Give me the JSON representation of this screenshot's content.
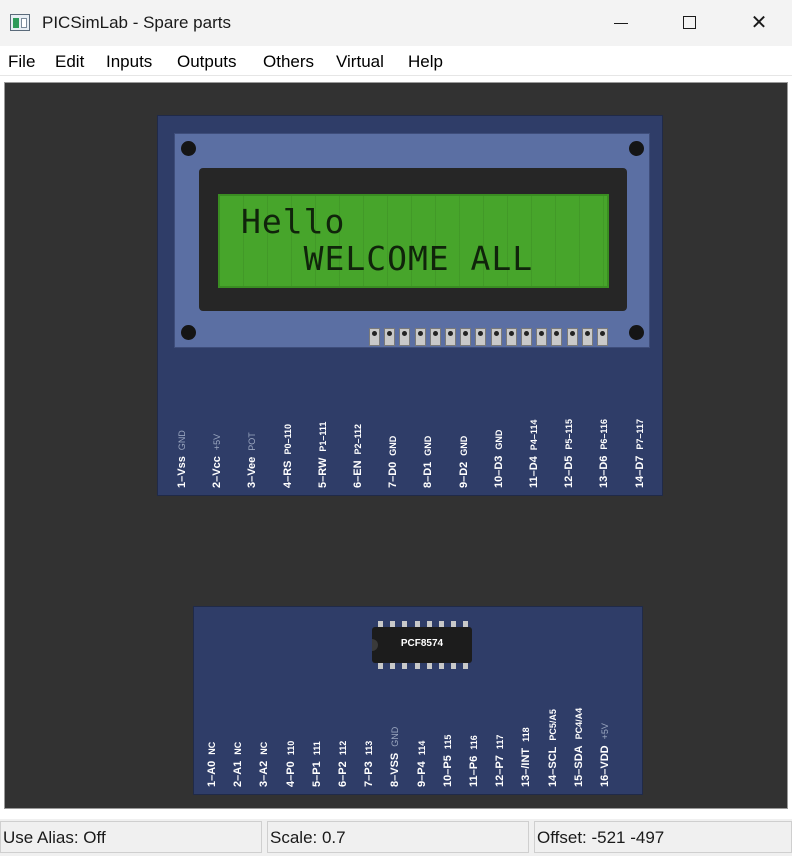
{
  "window": {
    "title": "PICSimLab - Spare parts"
  },
  "menu": [
    "File",
    "Edit",
    "Inputs",
    "Outputs",
    "Others",
    "Virtual",
    "Help"
  ],
  "lcd": {
    "line1": "Hello",
    "line2": "   WELCOME ALL",
    "pins": [
      {
        "name": "1–Vss",
        "sig": "GND",
        "dim": true
      },
      {
        "name": "2–Vcc",
        "sig": "+5V",
        "dim": true
      },
      {
        "name": "3–Vee",
        "sig": "POT",
        "dim": true
      },
      {
        "name": "4–RS",
        "sig": "P0–110",
        "dim": false
      },
      {
        "name": "5–RW",
        "sig": "P1–111",
        "dim": false
      },
      {
        "name": "6–EN",
        "sig": "P2–112",
        "dim": false
      },
      {
        "name": "7–D0",
        "sig": "GND",
        "dim": false
      },
      {
        "name": "8–D1",
        "sig": "GND",
        "dim": false
      },
      {
        "name": "9–D2",
        "sig": "GND",
        "dim": false
      },
      {
        "name": "10–D3",
        "sig": "GND",
        "dim": false
      },
      {
        "name": "11–D4",
        "sig": "P4–114",
        "dim": false
      },
      {
        "name": "12–D5",
        "sig": "P5–115",
        "dim": false
      },
      {
        "name": "13–D6",
        "sig": "P6–116",
        "dim": false
      },
      {
        "name": "14–D7",
        "sig": "P7–117",
        "dim": false
      }
    ]
  },
  "pcf": {
    "chip_label": "PCF8574",
    "pins": [
      {
        "name": "1–A0",
        "sig": "NC",
        "dim": false
      },
      {
        "name": "2–A1",
        "sig": "NC",
        "dim": false
      },
      {
        "name": "3–A2",
        "sig": "NC",
        "dim": false
      },
      {
        "name": "4–P0",
        "sig": "110",
        "dim": false
      },
      {
        "name": "5–P1",
        "sig": "111",
        "dim": false
      },
      {
        "name": "6–P2",
        "sig": "112",
        "dim": false
      },
      {
        "name": "7–P3",
        "sig": "113",
        "dim": false
      },
      {
        "name": "8–VSS",
        "sig": "GND",
        "dim": true
      },
      {
        "name": "9–P4",
        "sig": "114",
        "dim": false
      },
      {
        "name": "10–P5",
        "sig": "115",
        "dim": false
      },
      {
        "name": "11–P6",
        "sig": "116",
        "dim": false
      },
      {
        "name": "12–P7",
        "sig": "117",
        "dim": false
      },
      {
        "name": "13–/INT",
        "sig": "118",
        "dim": false
      },
      {
        "name": "14–SCL",
        "sig": "PC5/A5",
        "dim": false
      },
      {
        "name": "15–SDA",
        "sig": "PC4/A4",
        "dim": false
      },
      {
        "name": "16–VDD",
        "sig": "+5V",
        "dim": true
      }
    ]
  },
  "status": {
    "alias": "Use Alias: Off",
    "scale": "Scale: 0.7",
    "offset": "Offset: -521 -497"
  }
}
